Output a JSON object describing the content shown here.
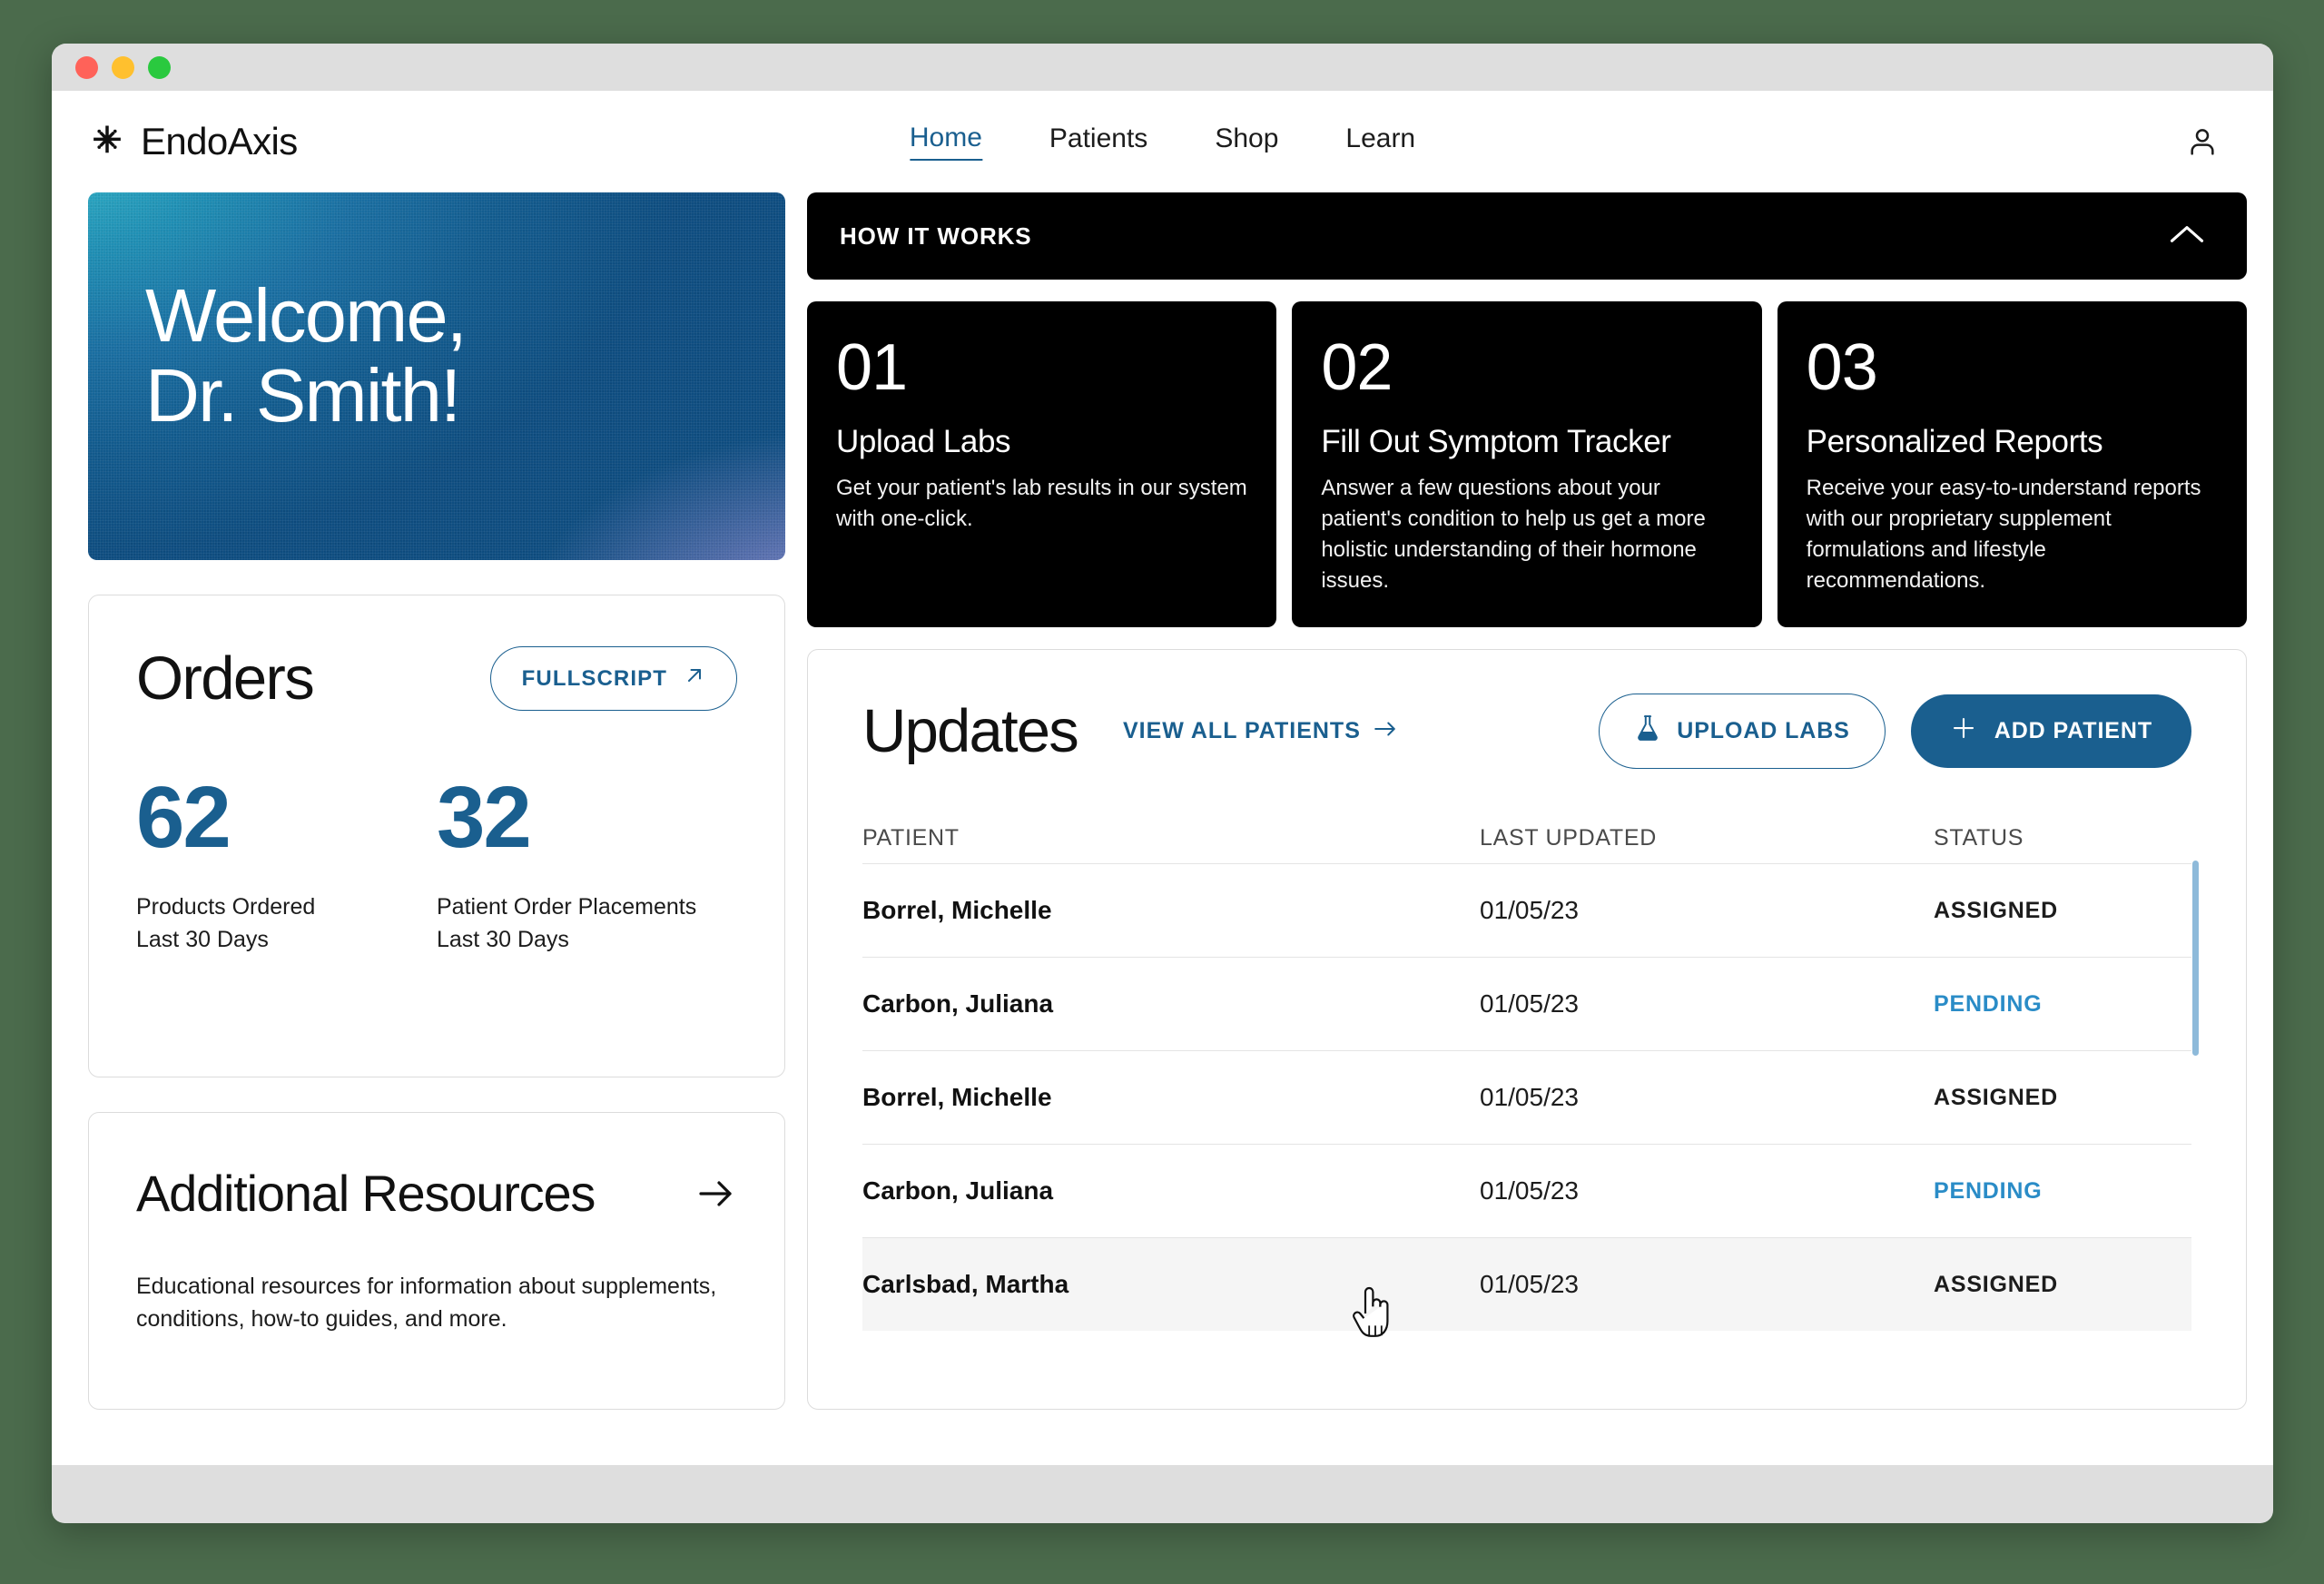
{
  "window": {
    "traffic_lights": [
      "close",
      "minimize",
      "maximize"
    ]
  },
  "header": {
    "brand": "EndoAxis",
    "brand_icon": "endoaxis-logo-icon",
    "nav": [
      {
        "label": "Home",
        "active": true
      },
      {
        "label": "Patients",
        "active": false
      },
      {
        "label": "Shop",
        "active": false
      },
      {
        "label": "Learn",
        "active": false
      }
    ],
    "profile_icon": "user-icon"
  },
  "hero": {
    "line1": "Welcome,",
    "line2": "Dr. Smith!"
  },
  "how_it_works": {
    "bar_label": "HOW IT WORKS",
    "collapse_icon": "chevron-up-icon",
    "cards": [
      {
        "number": "01",
        "title": "Upload Labs",
        "desc": "Get your patient's lab results in our system with one-click."
      },
      {
        "number": "02",
        "title": "Fill Out Symptom Tracker",
        "desc": "Answer a few questions about your patient's condition to help us get a more holistic understanding of their hormone issues."
      },
      {
        "number": "03",
        "title": "Personalized Reports",
        "desc": "Receive your easy-to-understand reports with our proprietary supplement formulations and lifestyle recommendations."
      }
    ]
  },
  "orders": {
    "title": "Orders",
    "fullscript_label": "FULLSCRIPT",
    "fullscript_icon": "arrow-up-right-icon",
    "stats": [
      {
        "value": "62",
        "label_line1": "Products Ordered",
        "label_line2": "Last 30 Days"
      },
      {
        "value": "32",
        "label_line1": "Patient Order Placements",
        "label_line2": "Last 30 Days"
      }
    ]
  },
  "resources": {
    "title": "Additional Resources",
    "arrow_icon": "arrow-right-icon",
    "desc_line1": "Educational resources for information about supplements,",
    "desc_line2": "conditions, how-to guides, and more."
  },
  "updates": {
    "title": "Updates",
    "view_all_label": "VIEW ALL PATIENTS",
    "view_all_icon": "arrow-right-icon",
    "upload_labs_label": "UPLOAD LABS",
    "upload_labs_icon": "flask-icon",
    "add_patient_label": "ADD PATIENT",
    "add_patient_icon": "plus-icon",
    "columns": [
      "PATIENT",
      "LAST UPDATED",
      "STATUS"
    ],
    "rows": [
      {
        "patient": "Borrel, Michelle",
        "last_updated": "01/05/23",
        "status": "ASSIGNED",
        "status_kind": "assigned",
        "hovered": false
      },
      {
        "patient": "Carbon, Juliana",
        "last_updated": "01/05/23",
        "status": "PENDING",
        "status_kind": "pending",
        "hovered": false
      },
      {
        "patient": "Borrel, Michelle",
        "last_updated": "01/05/23",
        "status": "ASSIGNED",
        "status_kind": "assigned",
        "hovered": false
      },
      {
        "patient": "Carbon, Juliana",
        "last_updated": "01/05/23",
        "status": "PENDING",
        "status_kind": "pending",
        "hovered": false
      },
      {
        "patient": "Carlsbad, Martha",
        "last_updated": "01/05/23",
        "status": "ASSIGNED",
        "status_kind": "assigned",
        "hovered": true
      }
    ]
  },
  "colors": {
    "accent_blue": "#1a5f8f",
    "pending_blue": "#2a8cc7",
    "black_card": "#000000",
    "page_bg": "#4b6b4c",
    "chrome_gray": "#dedede",
    "row_hover": "#f5f5f5",
    "scrollbar": "#8ebada"
  },
  "cursor": {
    "icon": "pointing-hand-cursor"
  }
}
